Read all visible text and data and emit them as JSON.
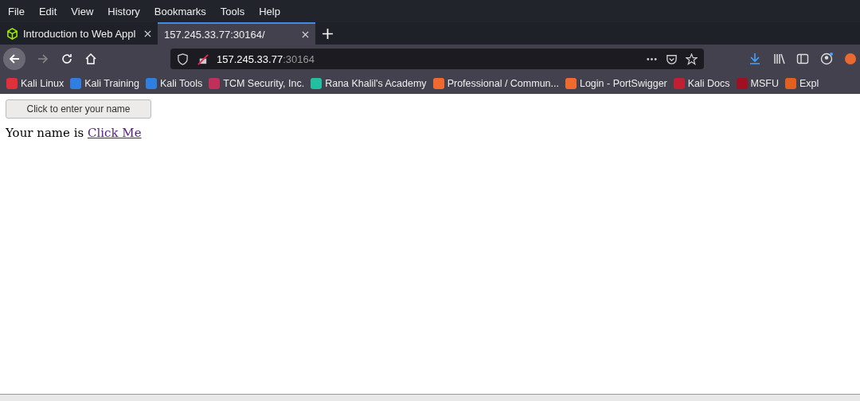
{
  "menu_bar": [
    "File",
    "Edit",
    "View",
    "History",
    "Bookmarks",
    "Tools",
    "Help"
  ],
  "tabs": [
    {
      "title": "Introduction to Web Appl",
      "selected": false,
      "kind": "site"
    },
    {
      "title": "157.245.33.77:30164/",
      "selected": true
    }
  ],
  "address_bar": {
    "host": "157.245.33.77",
    "port": ":30164"
  },
  "bookmarks": [
    {
      "label": "Kali Linux",
      "color": "#e0303a"
    },
    {
      "label": "Kali Training",
      "color": "#2f7fe0"
    },
    {
      "label": "Kali Tools",
      "color": "#2f7fe0"
    },
    {
      "label": "TCM Security, Inc.",
      "color": "#c0305a"
    },
    {
      "label": "Rana Khalil's Academy",
      "color": "#20c0a0"
    },
    {
      "label": "Professional / Commun...",
      "color": "#f06a30"
    },
    {
      "label": "Login - PortSwigger",
      "color": "#f06a30"
    },
    {
      "label": "Kali Docs",
      "color": "#c02030"
    },
    {
      "label": "MSFU",
      "color": "#a01020"
    },
    {
      "label": "Expl",
      "color": "#e06020"
    }
  ],
  "page": {
    "button": "Click to enter your name",
    "prefix": "Your name is",
    "link": "Click Me"
  }
}
